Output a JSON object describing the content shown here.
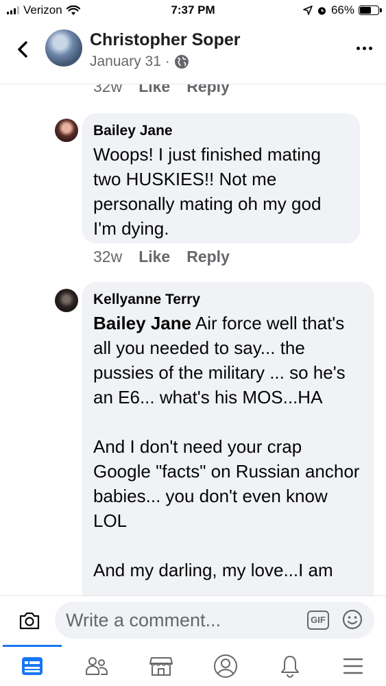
{
  "status_bar": {
    "carrier": "Verizon",
    "time": "7:37 PM",
    "battery": "66%",
    "battery_level": 0.66
  },
  "header": {
    "name": "Christopher Soper",
    "date": "January 31 ·"
  },
  "partial_meta": {
    "time": "32w",
    "like": "Like",
    "reply": "Reply"
  },
  "comments": [
    {
      "author": "Bailey Jane",
      "text": "Woops! I just finished mating two HUSKIES!! Not me personally mating oh my god I'm dying.",
      "time": "32w",
      "like": "Like",
      "reply": "Reply"
    },
    {
      "author": "Kellyanne Terry",
      "mention": "Bailey Jane",
      "text": " Air force well that's all you needed to say... the pussies of the military ... so he's an E6... what's his MOS...HA\n\nAnd I don't need your crap Google \"facts\" on Russian anchor babies... you don't even know LOL\n\nAnd my darling, my love...I am"
    }
  ],
  "composer": {
    "placeholder": "Write a comment...",
    "gif": "GIF"
  },
  "icons": {
    "back": "chevron-left-icon",
    "globe": "globe-icon",
    "more": "more-horizontal-icon",
    "camera": "camera-icon",
    "emoji": "smiley-icon",
    "tabs": [
      "news-feed-icon",
      "friends-icon",
      "marketplace-icon",
      "profile-icon",
      "notifications-icon",
      "menu-icon"
    ]
  },
  "colors": {
    "accent": "#1877f2",
    "bubble": "#f0f2f5",
    "secondary_text": "#65676b"
  }
}
